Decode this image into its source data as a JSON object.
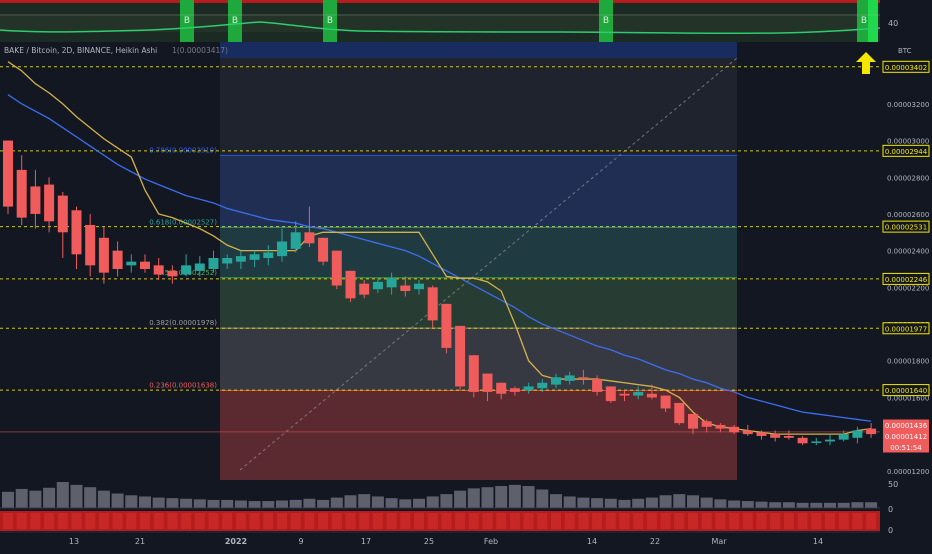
{
  "header": {
    "symbol_line": "BAKE / Bitcoin, 2D, BINANCE, Heikin Ashi",
    "value_line": "1(0.00003417)"
  },
  "indicator": {
    "label": "40",
    "signal_text": "B"
  },
  "volume_axis": [
    "50",
    "0",
    "0"
  ],
  "colors": {
    "background": "#131722",
    "bull": "#26a69a",
    "bear": "#f05b5b",
    "ma_blue": "#2962ff",
    "ma_yellow": "#d4b24a",
    "accent_yellow": "#f5e800",
    "fib_0236": "#f05b5b",
    "fib_0382": "#9e9e9e",
    "fib_05": "#4caf50",
    "fib_0618": "#26a69a",
    "fib_0786": "#2962ff"
  },
  "icons": {
    "arrow": "arrow-up-icon"
  },
  "chart_data": {
    "type": "candlestick",
    "title": "BAKE / Bitcoin, 2D, BINANCE, Heikin Ashi",
    "price_axis_label": "BTC",
    "yticks": [
      "0.00003200",
      "0.00003000",
      "0.00002800",
      "0.00002600",
      "0.00002400",
      "0.00002200",
      "0.00002000",
      "0.00001800",
      "0.00001600",
      "0.00001200"
    ],
    "ylim": [
      1.15e-05,
      3.45e-05
    ],
    "xticks": [
      "13",
      "21",
      "2022",
      "9",
      "17",
      "25",
      "Feb",
      "14",
      "22",
      "Mar",
      "14"
    ],
    "price_tags": [
      {
        "label": "0.00003402",
        "kind": "outline"
      },
      {
        "label": "0.00002944",
        "kind": "outline"
      },
      {
        "label": "0.00002531",
        "kind": "outline"
      },
      {
        "label": "0.00002246",
        "kind": "outline"
      },
      {
        "label": "0.00001977",
        "kind": "outline"
      },
      {
        "label": "0.00001640",
        "kind": "outline"
      },
      {
        "label": "0.00001436",
        "kind": "solid"
      },
      {
        "label": "0.00001412",
        "kind": "solid"
      },
      {
        "label": "00:51:54",
        "kind": "solid"
      }
    ],
    "fib_levels": [
      {
        "ratio": "0.786",
        "value": 2.919e-05,
        "label": "0.786(0.00002919)"
      },
      {
        "ratio": "0.618",
        "value": 2.527e-05,
        "label": "0.618(0.00002527)"
      },
      {
        "ratio": "0.5",
        "value": 2.252e-05,
        "label": "0.5(0.00002252)"
      },
      {
        "ratio": "0.382",
        "value": 1.978e-05,
        "label": "0.382(0.00001978)"
      },
      {
        "ratio": "0.236",
        "value": 1.638e-05,
        "label": "0.236(0.00001638)"
      }
    ],
    "candles": [
      {
        "o": 3e-05,
        "h": 3e-05,
        "l": 2.6e-05,
        "c": 2.64e-05
      },
      {
        "o": 2.84e-05,
        "h": 2.92e-05,
        "l": 2.54e-05,
        "c": 2.58e-05
      },
      {
        "o": 2.75e-05,
        "h": 2.84e-05,
        "l": 2.52e-05,
        "c": 2.6e-05
      },
      {
        "o": 2.76e-05,
        "h": 2.8e-05,
        "l": 2.5e-05,
        "c": 2.56e-05
      },
      {
        "o": 2.7e-05,
        "h": 2.72e-05,
        "l": 2.36e-05,
        "c": 2.5e-05
      },
      {
        "o": 2.62e-05,
        "h": 2.64e-05,
        "l": 2.3e-05,
        "c": 2.38e-05
      },
      {
        "o": 2.54e-05,
        "h": 2.6e-05,
        "l": 2.26e-05,
        "c": 2.32e-05
      },
      {
        "o": 2.47e-05,
        "h": 2.53e-05,
        "l": 2.22e-05,
        "c": 2.28e-05
      },
      {
        "o": 2.4e-05,
        "h": 2.45e-05,
        "l": 2.26e-05,
        "c": 2.3e-05
      },
      {
        "o": 2.32e-05,
        "h": 2.38e-05,
        "l": 2.28e-05,
        "c": 2.34e-05
      },
      {
        "o": 2.34e-05,
        "h": 2.38e-05,
        "l": 2.28e-05,
        "c": 2.3e-05
      },
      {
        "o": 2.32e-05,
        "h": 2.36e-05,
        "l": 2.24e-05,
        "c": 2.27e-05
      },
      {
        "o": 2.29e-05,
        "h": 2.32e-05,
        "l": 2.22e-05,
        "c": 2.26e-05
      },
      {
        "o": 2.27e-05,
        "h": 2.38e-05,
        "l": 2.26e-05,
        "c": 2.32e-05
      },
      {
        "o": 2.29e-05,
        "h": 2.37e-05,
        "l": 2.26e-05,
        "c": 2.33e-05
      },
      {
        "o": 2.3e-05,
        "h": 2.4e-05,
        "l": 2.28e-05,
        "c": 2.36e-05
      },
      {
        "o": 2.33e-05,
        "h": 2.38e-05,
        "l": 2.3e-05,
        "c": 2.36e-05
      },
      {
        "o": 2.34e-05,
        "h": 2.4e-05,
        "l": 2.3e-05,
        "c": 2.37e-05
      },
      {
        "o": 2.35e-05,
        "h": 2.4e-05,
        "l": 2.31e-05,
        "c": 2.38e-05
      },
      {
        "o": 2.36e-05,
        "h": 2.43e-05,
        "l": 2.32e-05,
        "c": 2.39e-05
      },
      {
        "o": 2.37e-05,
        "h": 2.52e-05,
        "l": 2.34e-05,
        "c": 2.45e-05
      },
      {
        "o": 2.41e-05,
        "h": 2.56e-05,
        "l": 2.39e-05,
        "c": 2.5e-05
      },
      {
        "o": 2.5e-05,
        "h": 2.64e-05,
        "l": 2.42e-05,
        "c": 2.44e-05
      },
      {
        "o": 2.47e-05,
        "h": 2.47e-05,
        "l": 2.32e-05,
        "c": 2.34e-05
      },
      {
        "o": 2.4e-05,
        "h": 2.4e-05,
        "l": 2.19e-05,
        "c": 2.21e-05
      },
      {
        "o": 2.29e-05,
        "h": 2.29e-05,
        "l": 2.12e-05,
        "c": 2.14e-05
      },
      {
        "o": 2.22e-05,
        "h": 2.24e-05,
        "l": 2.14e-05,
        "c": 2.16e-05
      },
      {
        "o": 2.19e-05,
        "h": 2.25e-05,
        "l": 2.17e-05,
        "c": 2.23e-05
      },
      {
        "o": 2.2e-05,
        "h": 2.28e-05,
        "l": 2.16e-05,
        "c": 2.25e-05
      },
      {
        "o": 2.21e-05,
        "h": 2.26e-05,
        "l": 2.15e-05,
        "c": 2.18e-05
      },
      {
        "o": 2.19e-05,
        "h": 2.24e-05,
        "l": 2.16e-05,
        "c": 2.22e-05
      },
      {
        "o": 2.2e-05,
        "h": 2.21e-05,
        "l": 1.98e-05,
        "c": 2.02e-05
      },
      {
        "o": 2.11e-05,
        "h": 2.11e-05,
        "l": 1.84e-05,
        "c": 1.87e-05
      },
      {
        "o": 1.99e-05,
        "h": 1.99e-05,
        "l": 1.64e-05,
        "c": 1.66e-05
      },
      {
        "o": 1.83e-05,
        "h": 1.83e-05,
        "l": 1.6e-05,
        "c": 1.63e-05
      },
      {
        "o": 1.73e-05,
        "h": 1.73e-05,
        "l": 1.58e-05,
        "c": 1.63e-05
      },
      {
        "o": 1.68e-05,
        "h": 1.68e-05,
        "l": 1.59e-05,
        "c": 1.62e-05
      },
      {
        "o": 1.65e-05,
        "h": 1.66e-05,
        "l": 1.61e-05,
        "c": 1.63e-05
      },
      {
        "o": 1.64e-05,
        "h": 1.68e-05,
        "l": 1.62e-05,
        "c": 1.66e-05
      },
      {
        "o": 1.65e-05,
        "h": 1.7e-05,
        "l": 1.63e-05,
        "c": 1.68e-05
      },
      {
        "o": 1.67e-05,
        "h": 1.73e-05,
        "l": 1.65e-05,
        "c": 1.71e-05
      },
      {
        "o": 1.69e-05,
        "h": 1.74e-05,
        "l": 1.67e-05,
        "c": 1.72e-05
      },
      {
        "o": 1.71e-05,
        "h": 1.75e-05,
        "l": 1.67e-05,
        "c": 1.7e-05
      },
      {
        "o": 1.7e-05,
        "h": 1.72e-05,
        "l": 1.61e-05,
        "c": 1.63e-05
      },
      {
        "o": 1.66e-05,
        "h": 1.66e-05,
        "l": 1.57e-05,
        "c": 1.58e-05
      },
      {
        "o": 1.62e-05,
        "h": 1.64e-05,
        "l": 1.58e-05,
        "c": 1.61e-05
      },
      {
        "o": 1.61e-05,
        "h": 1.66e-05,
        "l": 1.59e-05,
        "c": 1.63e-05
      },
      {
        "o": 1.62e-05,
        "h": 1.67e-05,
        "l": 1.59e-05,
        "c": 1.6e-05
      },
      {
        "o": 1.61e-05,
        "h": 1.61e-05,
        "l": 1.52e-05,
        "c": 1.54e-05
      },
      {
        "o": 1.57e-05,
        "h": 1.57e-05,
        "l": 1.45e-05,
        "c": 1.46e-05
      },
      {
        "o": 1.51e-05,
        "h": 1.51e-05,
        "l": 1.4e-05,
        "c": 1.43e-05
      },
      {
        "o": 1.47e-05,
        "h": 1.48e-05,
        "l": 1.41e-05,
        "c": 1.44e-05
      },
      {
        "o": 1.45e-05,
        "h": 1.46e-05,
        "l": 1.41e-05,
        "c": 1.43e-05
      },
      {
        "o": 1.44e-05,
        "h": 1.45e-05,
        "l": 1.4e-05,
        "c": 1.41e-05
      },
      {
        "o": 1.42e-05,
        "h": 1.45e-05,
        "l": 1.39e-05,
        "c": 1.4e-05
      },
      {
        "o": 1.41e-05,
        "h": 1.42e-05,
        "l": 1.37e-05,
        "c": 1.39e-05
      },
      {
        "o": 1.4e-05,
        "h": 1.42e-05,
        "l": 1.36e-05,
        "c": 1.38e-05
      },
      {
        "o": 1.39e-05,
        "h": 1.42e-05,
        "l": 1.37e-05,
        "c": 1.38e-05
      },
      {
        "o": 1.38e-05,
        "h": 1.39e-05,
        "l": 1.34e-05,
        "c": 1.35e-05
      },
      {
        "o": 1.36e-05,
        "h": 1.38e-05,
        "l": 1.34e-05,
        "c": 1.36e-05
      },
      {
        "o": 1.36e-05,
        "h": 1.4e-05,
        "l": 1.34e-05,
        "c": 1.37e-05
      },
      {
        "o": 1.37e-05,
        "h": 1.42e-05,
        "l": 1.36e-05,
        "c": 1.4e-05
      },
      {
        "o": 1.38e-05,
        "h": 1.44e-05,
        "l": 1.35e-05,
        "c": 1.42e-05
      },
      {
        "o": 1.43e-05,
        "h": 1.46e-05,
        "l": 1.38e-05,
        "c": 1.4e-05
      }
    ],
    "ma_blue": [
      3.25e-05,
      3.2e-05,
      3.16e-05,
      3.12e-05,
      3.07e-05,
      3.02e-05,
      2.97e-05,
      2.92e-05,
      2.87e-05,
      2.83e-05,
      2.79e-05,
      2.76e-05,
      2.73e-05,
      2.7e-05,
      2.68e-05,
      2.66e-05,
      2.63e-05,
      2.61e-05,
      2.59e-05,
      2.57e-05,
      2.56e-05,
      2.55e-05,
      2.53e-05,
      2.52e-05,
      2.5e-05,
      2.48e-05,
      2.46e-05,
      2.44e-05,
      2.42e-05,
      2.4e-05,
      2.37e-05,
      2.33e-05,
      2.29e-05,
      2.25e-05,
      2.21e-05,
      2.17e-05,
      2.13e-05,
      2.09e-05,
      2.04e-05,
      2e-05,
      1.97e-05,
      1.94e-05,
      1.91e-05,
      1.88e-05,
      1.86e-05,
      1.83e-05,
      1.81e-05,
      1.78e-05,
      1.75e-05,
      1.73e-05,
      1.7e-05,
      1.68e-05,
      1.65e-05,
      1.63e-05,
      1.6e-05,
      1.58e-05,
      1.56e-05,
      1.54e-05,
      1.52e-05,
      1.51e-05,
      1.5e-05,
      1.49e-05,
      1.48e-05,
      1.47e-05
    ],
    "ma_yellow": [
      3.43e-05,
      3.38e-05,
      3.31e-05,
      3.26e-05,
      3.2e-05,
      3.13e-05,
      3.07e-05,
      3.01e-05,
      2.96e-05,
      2.91e-05,
      2.73e-05,
      2.6e-05,
      2.58e-05,
      2.55e-05,
      2.52e-05,
      2.48e-05,
      2.43e-05,
      2.4e-05,
      2.4e-05,
      2.4e-05,
      2.4e-05,
      2.4e-05,
      2.48e-05,
      2.5e-05,
      2.5e-05,
      2.5e-05,
      2.5e-05,
      2.5e-05,
      2.5e-05,
      2.5e-05,
      2.5e-05,
      2.38e-05,
      2.26e-05,
      2.25e-05,
      2.25e-05,
      2.23e-05,
      2.18e-05,
      2e-05,
      1.8e-05,
      1.72e-05,
      1.7e-05,
      1.7e-05,
      1.7e-05,
      1.7e-05,
      1.69e-05,
      1.68e-05,
      1.67e-05,
      1.66e-05,
      1.64e-05,
      1.6e-05,
      1.52e-05,
      1.46e-05,
      1.44e-05,
      1.43e-05,
      1.42e-05,
      1.41e-05,
      1.4e-05,
      1.4e-05,
      1.4e-05,
      1.4e-05,
      1.4e-05,
      1.4e-05,
      1.42e-05,
      1.43e-05
    ],
    "volumes": [
      28,
      33,
      30,
      35,
      45,
      40,
      36,
      30,
      25,
      22,
      20,
      18,
      17,
      16,
      15,
      14,
      14,
      13,
      12,
      12,
      13,
      14,
      16,
      14,
      18,
      22,
      24,
      20,
      17,
      15,
      16,
      20,
      24,
      30,
      34,
      36,
      38,
      40,
      38,
      32,
      24,
      20,
      18,
      17,
      16,
      14,
      16,
      18,
      22,
      24,
      22,
      18,
      15,
      13,
      12,
      11,
      10,
      10,
      9,
      9,
      9,
      9,
      10,
      10
    ],
    "signals": [
      "B",
      "B",
      "B",
      "B",
      "B",
      "B"
    ]
  }
}
